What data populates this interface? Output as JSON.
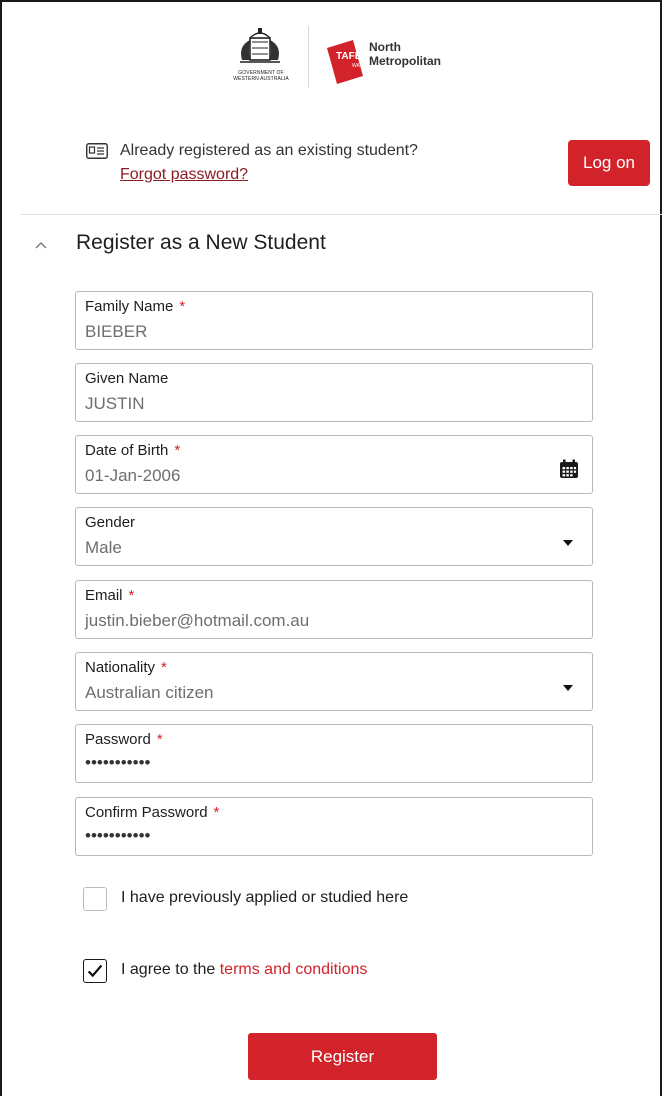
{
  "header": {
    "gov_logo_text": "GOVERNMENT OF WESTERN AUSTRALIA",
    "tafe_mark": "TAFE",
    "tafe_sub": "WA",
    "institute_line1": "North",
    "institute_line2": "Metropolitan"
  },
  "existing": {
    "prompt": "Already registered as an existing student?",
    "forgot_link": "Forgot password?",
    "logon_button": "Log on"
  },
  "section": {
    "title": "Register as a New Student"
  },
  "fields": {
    "family_name": {
      "label": "Family Name",
      "required": "*",
      "value": "BIEBER"
    },
    "given_name": {
      "label": "Given Name",
      "value": "JUSTIN"
    },
    "dob": {
      "label": "Date of Birth",
      "required": "*",
      "value": "01-Jan-2006"
    },
    "gender": {
      "label": "Gender",
      "value": "Male"
    },
    "email": {
      "label": "Email",
      "required": "*",
      "value": "justin.bieber@hotmail.com.au"
    },
    "nationality": {
      "label": "Nationality",
      "required": "*",
      "value": "Australian citizen"
    },
    "password": {
      "label": "Password",
      "required": "*",
      "value": "•••••••••••"
    },
    "confirm_password": {
      "label": "Confirm Password",
      "required": "*",
      "value": "•••••••••••"
    }
  },
  "checkboxes": {
    "previously_applied": {
      "label": "I have previously applied or studied here",
      "checked": false
    },
    "agree": {
      "label_prefix": "I agree to the ",
      "link": "terms and conditions",
      "checked": true
    }
  },
  "register_button": "Register",
  "colors": {
    "accent": "#d2232a",
    "link_dark": "#8a1c22"
  }
}
